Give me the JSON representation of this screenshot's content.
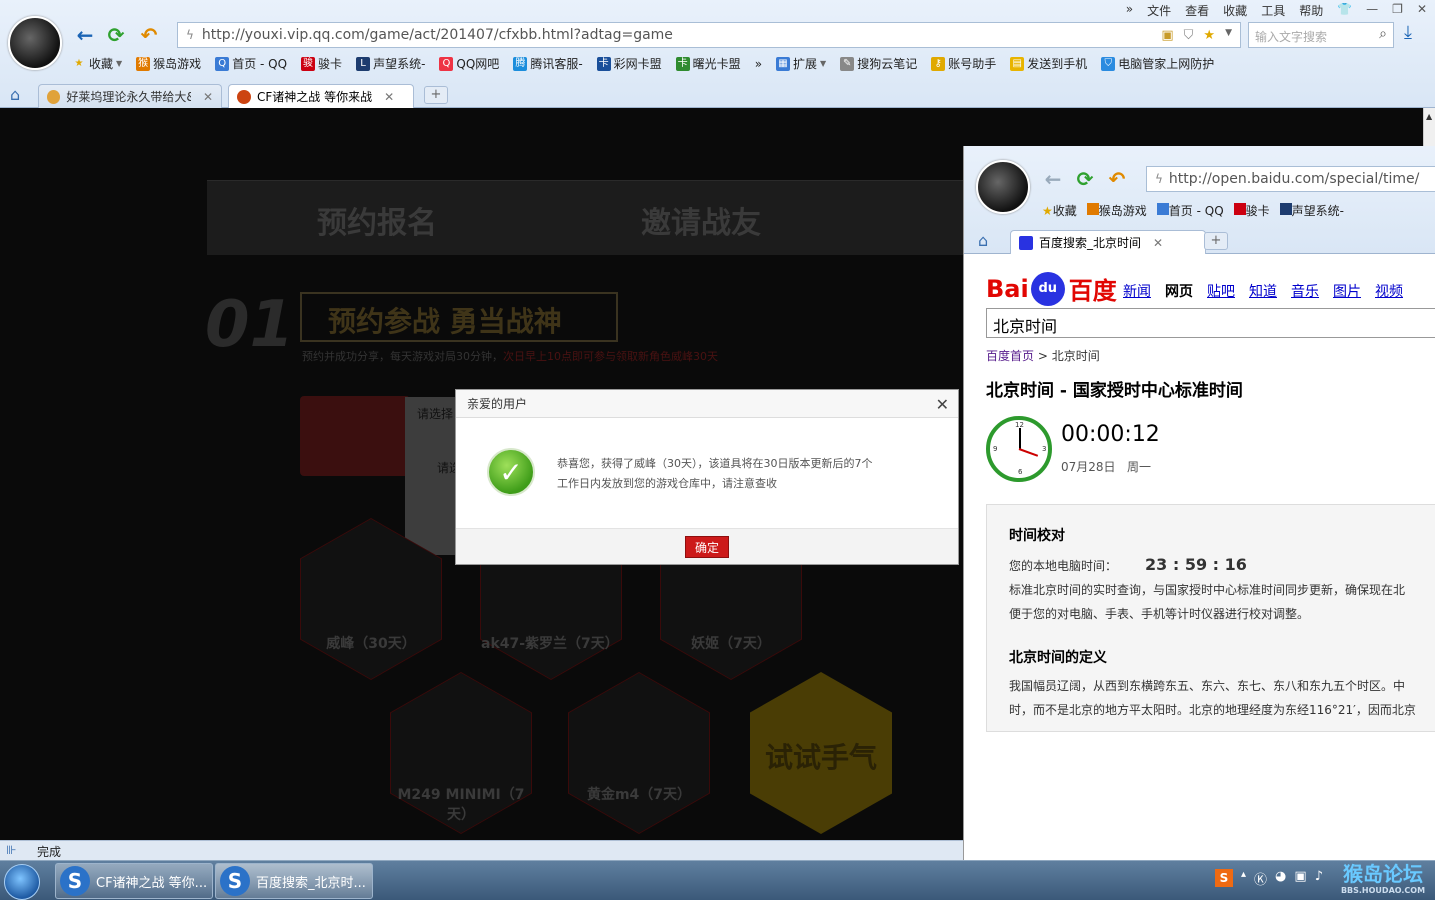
{
  "menu": [
    "»",
    "文件",
    "查看",
    "收藏",
    "工具",
    "帮助"
  ],
  "browser": {
    "url": "http://youxi.vip.qq.com/game/act/201407/cfxbb.html?adtag=game",
    "search_placeholder": "输入文字搜索",
    "bookmarks": [
      "收藏",
      "猴岛游戏",
      "首页 - QQ",
      "骏卡",
      "声望系统-",
      "QQ网吧",
      "腾讯客服-",
      "彩网卡盟",
      "曙光卡盟",
      "»",
      "扩展",
      "搜狗云笔记",
      "账号助手",
      "发送到手机",
      "电脑管家上网防护"
    ],
    "tabs": [
      {
        "label": "好莱坞理论永久带给大&",
        "active": false
      },
      {
        "label": "CF诸神之战 等你来战",
        "active": true
      }
    ],
    "new_tab": "+"
  },
  "page": {
    "tab1": "预约报名",
    "tab2": "邀请战友",
    "step_number": "01",
    "slogan": "预约参战 勇当战神",
    "subtext_normal": "预约并成功分享，每天游戏对局30分钟，",
    "subtext_red": "次日早上10点即可参与领取新角色威峰30天",
    "ghost_title": "请选择",
    "ghost_body": "请选",
    "items": [
      "威峰（30天）",
      "ak47-紫罗兰（7天）",
      "妖姬（7天）",
      "M249 MINIMI（7天）",
      "黄金m4（7天）"
    ],
    "try_luck": "试试手气"
  },
  "modal": {
    "title": "亲爱的用户",
    "message": "恭喜您，获得了威峰（30天），该道具将在30日版本更新后的7个工作日内发放到您的游戏仓库中，请注意查收",
    "ok": "确定"
  },
  "status": {
    "text": "完成"
  },
  "win2": {
    "url": "http://open.baidu.com/special/time/",
    "bookmarks": [
      "收藏",
      "猴岛游戏",
      "首页 - QQ",
      "骏卡",
      "声望系统-"
    ],
    "tab_label": "百度搜索_北京时间",
    "logo_bai": "Bai",
    "logo_du": "du",
    "logo_cn": "百度",
    "nav": [
      "新闻",
      "网页",
      "贴吧",
      "知道",
      "音乐",
      "图片",
      "视频"
    ],
    "search_value": "北京时间",
    "crumb_home": "百度首页",
    "crumb_sep": ">",
    "crumb_current": "北京时间",
    "title": "北京时间 - 国家授时中心标准时间",
    "clock_numbers": [
      "12",
      "3",
      "6",
      "9"
    ],
    "time": "00:00:12",
    "date": "07月28日",
    "weekday": "周一",
    "section1_title": "时间校对",
    "local_label": "您的本地电脑时间：",
    "local_time": "23 : 59 : 16",
    "line1": "标准北京时间的实时查询，与国家授时中心标准时间同步更新，确保现在北",
    "line2": "便于您的对电脑、手表、手机等计时仪器进行校对调整。",
    "section2_title": "北京时间的定义",
    "line3": "我国幅员辽阔，从西到东横跨东五、东六、东七、东八和东九五个时区。中",
    "line4": "时，而不是北京的地方平太阳时。北京的地理经度为东经116°21′，因而北京"
  },
  "taskbar": {
    "items": [
      "CF诸神之战 等你...",
      "百度搜索_北京时..."
    ],
    "watermark": "猴岛论坛",
    "watermark_sub": "BBS.HOUDAO.COM"
  }
}
